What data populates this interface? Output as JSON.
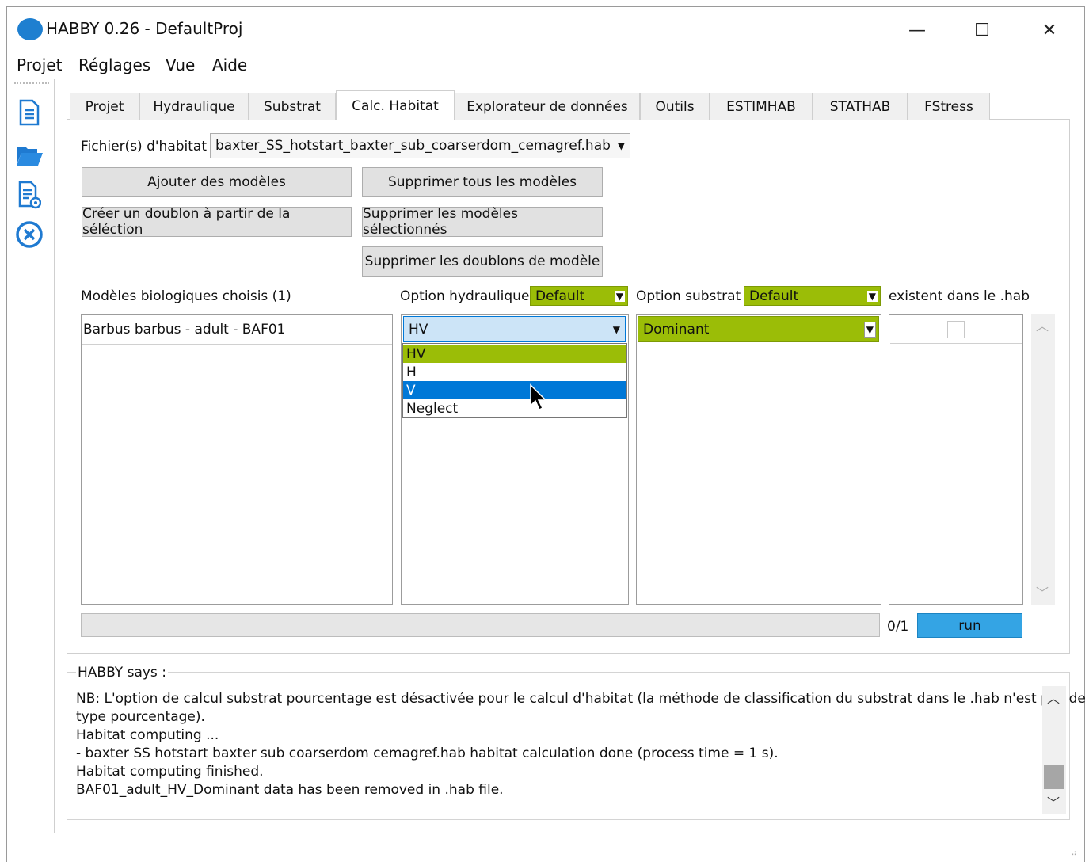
{
  "window": {
    "title": "HABBY 0.26 - DefaultProj",
    "minimize_glyph": "—",
    "maximize_glyph": "☐",
    "close_glyph": "✕"
  },
  "menu": [
    "Projet",
    "Réglages",
    "Vue",
    "Aide"
  ],
  "sidebar_icons": [
    "new-file-icon",
    "open-folder-icon",
    "report-icon",
    "close-project-icon"
  ],
  "tabs": [
    "Projet",
    "Hydraulique",
    "Substrat",
    "Calc. Habitat",
    "Explorateur de données",
    "Outils",
    "ESTIMHAB",
    "STATHAB",
    "FStress"
  ],
  "active_tab": "Calc. Habitat",
  "habitat_file": {
    "label": "Fichier(s) d'habitat",
    "value": "baxter_SS_hotstart_baxter_sub_coarserdom_cemagref.hab"
  },
  "buttons": {
    "add_models": "Ajouter des modèles",
    "delete_all_models": "Supprimer tous les modèles",
    "create_duplicate": "Créer un doublon à partir de la séléction",
    "delete_selected_models": "Supprimer les modèles sélectionnés",
    "delete_duplicates": "Supprimer les doublons de modèle",
    "run": "run"
  },
  "models": {
    "header": "Modèles biologiques choisis (1)",
    "items": [
      "Barbus barbus - adult - BAF01"
    ]
  },
  "hydraulic_option": {
    "label": "Option hydraulique",
    "default_value": "Default",
    "row_value": "HV",
    "dropdown_options": [
      "HV",
      "H",
      "V",
      "Neglect"
    ],
    "highlighted_option": "V"
  },
  "substrate_option": {
    "label": "Option substrat",
    "default_value": "Default",
    "row_value": "Dominant"
  },
  "exists_in_hab": {
    "label": "existent dans le .hab",
    "checked": false
  },
  "progress": {
    "text": "0/1",
    "value": 0
  },
  "log": {
    "title": "HABBY says :",
    "lines": [
      "NB: L'option de calcul substrat pourcentage est désactivée pour le calcul d'habitat (la méthode de classification du substrat dans le .hab n'est pas de",
      "type pourcentage).",
      "Habitat computing ...",
      "- baxter SS hotstart baxter sub coarserdom cemagref.hab habitat calculation done (process time = 1 s).",
      "Habitat computing finished.",
      "BAF01_adult_HV_Dominant data has been removed in .hab file."
    ]
  },
  "colors": {
    "accent_green": "#9bbd07",
    "selection_blue": "#0078d7",
    "run_button": "#34a4e4",
    "combo_blue": "#cce4f7"
  }
}
